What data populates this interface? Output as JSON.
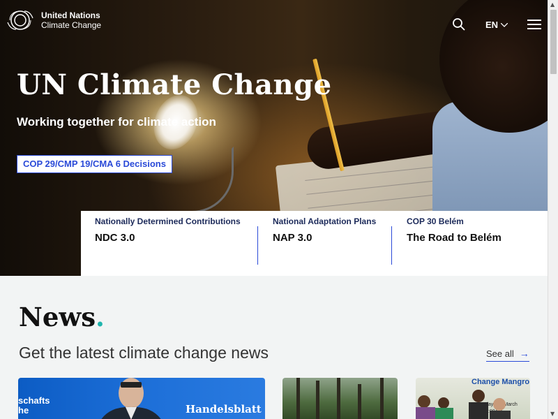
{
  "header": {
    "logo_line1": "United Nations",
    "logo_line2": "Climate Change",
    "language": "EN",
    "icons": {
      "search": "search-icon",
      "language_chevron": "chevron-down-icon",
      "menu": "hamburger-menu-icon",
      "logo": "un-climate-logo-icon"
    }
  },
  "hero": {
    "title": "UN Climate Change",
    "subtitle": "Working together for climate action",
    "cta_label": "COP 29/CMP 19/CMA 6 Decisions"
  },
  "features": [
    {
      "kicker": "Nationally Determined Contributions",
      "title": "NDC 3.0"
    },
    {
      "kicker": "National Adaptation Plans",
      "title": "NAP 3.0"
    },
    {
      "kicker": "COP 30 Belém",
      "title": "The Road to Belém"
    }
  ],
  "news": {
    "heading": "News",
    "heading_dot": ".",
    "subheading": "Get the latest climate change news",
    "see_all_label": "See all",
    "cards": [
      {
        "image_text_left": "schafts\nhe",
        "image_text_brand": "Handelsblatt"
      },
      {
        "image_text": ""
      },
      {
        "image_banner": "Change Mangro",
        "image_date": "day, 6th March\n3:00AM"
      }
    ]
  },
  "colors": {
    "accent": "#2a4ad8",
    "news_dot": "#1fb5ad",
    "kicker": "#1c2a5a",
    "section_bg": "#f2f4f4"
  }
}
